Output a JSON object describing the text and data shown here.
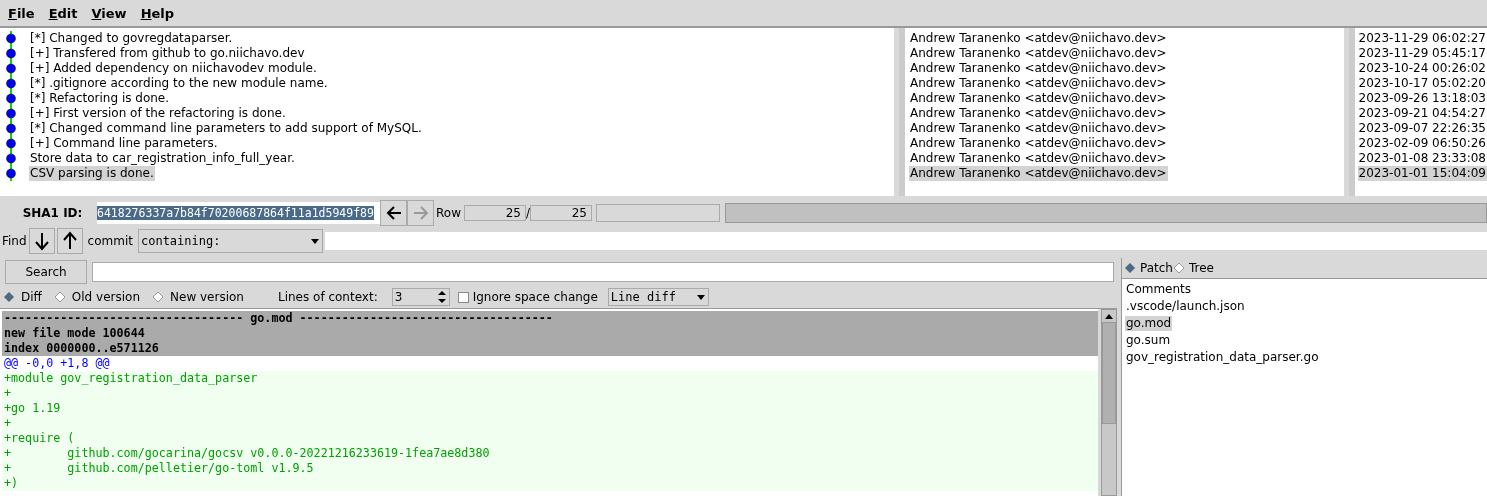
{
  "menu": [
    {
      "label": "File"
    },
    {
      "label": "Edit"
    },
    {
      "label": "View"
    },
    {
      "label": "Help"
    }
  ],
  "commits": [
    {
      "message": "[*] Changed to govregdataparser.",
      "author": "Andrew Taranenko <atdev@niichavo.dev>",
      "date": "2023-11-29 06:02:27",
      "selected": false
    },
    {
      "message": "[+] Transfered from github to go.niichavo.dev",
      "author": "Andrew Taranenko <atdev@niichavo.dev>",
      "date": "2023-11-29 05:45:17",
      "selected": false
    },
    {
      "message": "[+] Added dependency on niichavodev module.",
      "author": "Andrew Taranenko <atdev@niichavo.dev>",
      "date": "2023-10-24 00:26:02",
      "selected": false
    },
    {
      "message": "[*] .gitignore according to the new module name.",
      "author": "Andrew Taranenko <atdev@niichavo.dev>",
      "date": "2023-10-17 05:02:20",
      "selected": false
    },
    {
      "message": "[*] Refactoring is done.",
      "author": "Andrew Taranenko <atdev@niichavo.dev>",
      "date": "2023-09-26 13:18:03",
      "selected": false
    },
    {
      "message": "[+] First version of the refactoring is done.",
      "author": "Andrew Taranenko <atdev@niichavo.dev>",
      "date": "2023-09-21 04:54:27",
      "selected": false
    },
    {
      "message": "[*] Changed command line parameters to add support of MySQL.",
      "author": "Andrew Taranenko <atdev@niichavo.dev>",
      "date": "2023-09-07 22:26:35",
      "selected": false
    },
    {
      "message": "[+] Command line parameters.",
      "author": "Andrew Taranenko <atdev@niichavo.dev>",
      "date": "2023-02-09 06:50:26",
      "selected": false
    },
    {
      "message": "Store data to car_registration_info_full_year.",
      "author": "Andrew Taranenko <atdev@niichavo.dev>",
      "date": "2023-01-08 23:33:08",
      "selected": false
    },
    {
      "message": "CSV parsing is done.",
      "author": "Andrew Taranenko <atdev@niichavo.dev>",
      "date": "2023-01-01 15:04:09",
      "selected": true
    }
  ],
  "sha": {
    "label": "SHA1 ID:",
    "value": "6418276337a7b84f70200687864f11a1d5949f89"
  },
  "nav": {
    "back_disabled": false,
    "forward_disabled": true
  },
  "progress": {
    "level": 1
  },
  "row": {
    "label": "Row",
    "current": "25",
    "separator": "/",
    "total": "25"
  },
  "find": {
    "label": "Find",
    "type": "commit",
    "mode": "containing:"
  },
  "search_button": "Search",
  "view_modes": [
    {
      "label": "Diff",
      "selected": true
    },
    {
      "label": "Old version",
      "selected": false
    },
    {
      "label": "New version",
      "selected": false
    }
  ],
  "context": {
    "label": "Lines of context:",
    "value": "3"
  },
  "ignore_space": {
    "label": "Ignore space change",
    "checked": false
  },
  "diff_mode": "Line diff",
  "diff": [
    {
      "kind": "header",
      "text": "---------------------------------- go.mod ------------------------------------"
    },
    {
      "kind": "header",
      "text": "new file mode 100644"
    },
    {
      "kind": "header",
      "text": "index 0000000..e571126"
    },
    {
      "kind": "hunk",
      "text": "@@ -0,0 +1,8 @@"
    },
    {
      "kind": "add",
      "text": "+module gov_registration_data_parser"
    },
    {
      "kind": "add",
      "text": "+"
    },
    {
      "kind": "add",
      "text": "+go 1.19"
    },
    {
      "kind": "add",
      "text": "+"
    },
    {
      "kind": "add",
      "text": "+require ("
    },
    {
      "kind": "add",
      "text": "+        github.com/gocarina/gocsv v0.0.0-20221216233619-1fea7ae8d380"
    },
    {
      "kind": "add",
      "text": "+        github.com/pelletier/go-toml v1.9.5"
    },
    {
      "kind": "add",
      "text": "+)"
    }
  ],
  "file_modes": [
    {
      "label": "Patch",
      "selected": true
    },
    {
      "label": "Tree",
      "selected": false
    }
  ],
  "files": [
    {
      "name": "Comments",
      "selected": false
    },
    {
      "name": ".vscode/launch.json",
      "selected": false
    },
    {
      "name": "go.mod",
      "selected": true
    },
    {
      "name": "go.sum",
      "selected": false
    },
    {
      "name": "gov_registration_data_parser.go",
      "selected": false
    }
  ]
}
